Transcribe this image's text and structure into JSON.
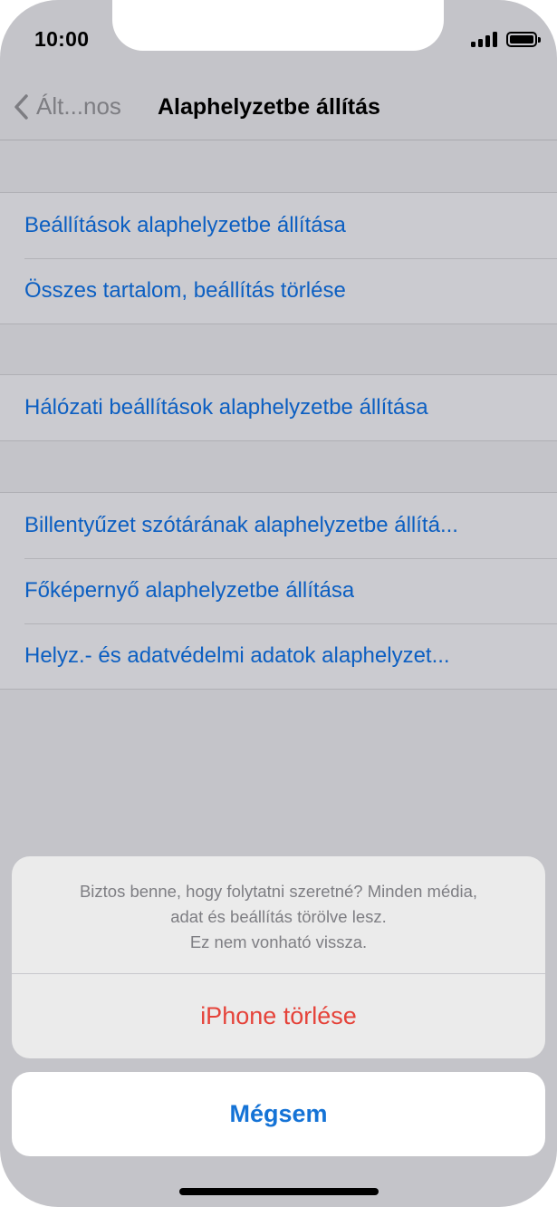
{
  "status_bar": {
    "time": "10:00",
    "icons": [
      "cellular-signal-icon",
      "battery-icon"
    ]
  },
  "nav": {
    "back_label": "Ált...nos",
    "title": "Alaphelyzetbe állítás"
  },
  "groups": [
    {
      "items": [
        {
          "label": "Beállítások alaphelyzetbe állítása"
        },
        {
          "label": "Összes tartalom, beállítás törlése"
        }
      ]
    },
    {
      "items": [
        {
          "label": "Hálózati beállítások alaphelyzetbe állítása"
        }
      ]
    },
    {
      "items": [
        {
          "label": "Billentyűzet szótárának alaphelyzetbe állítá..."
        },
        {
          "label": "Főképernyő alaphelyzetbe állítása"
        },
        {
          "label": "Helyz.- és adatvédelmi adatok alaphelyzet..."
        }
      ]
    }
  ],
  "action_sheet": {
    "message_lines": [
      "Biztos benne, hogy folytatni szeretné? Minden média,",
      "adat és beállítás törölve lesz.",
      "Ez nem vonható vissza."
    ],
    "destructive_label": "iPhone törlése",
    "cancel_label": "Mégsem"
  },
  "colors": {
    "link_blue": "#0c5fc2",
    "destructive_red": "#e5433a",
    "cancel_blue": "#1573d6"
  }
}
